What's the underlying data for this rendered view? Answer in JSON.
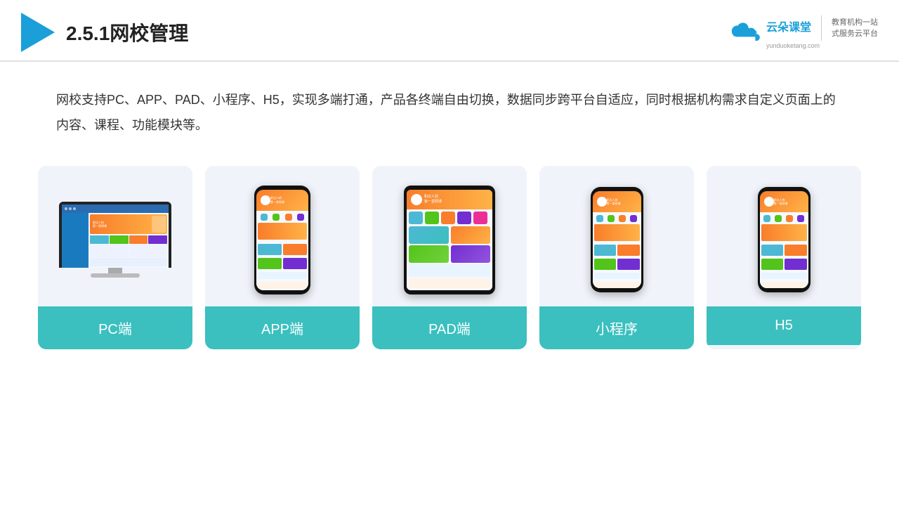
{
  "header": {
    "title": "2.5.1网校管理",
    "brand_cn": "云朵课堂",
    "brand_en": "yunduoketang.com",
    "brand_sub1": "教育机构一站",
    "brand_sub2": "式服务云平台"
  },
  "description": {
    "text": "网校支持PC、APP、PAD、小程序、H5，实现多端打通，产品各终端自由切换，数据同步跨平台自适应，同时根据机构需求自定义页面上的内容、课程、功能模块等。"
  },
  "cards": [
    {
      "id": "pc",
      "label": "PC端"
    },
    {
      "id": "app",
      "label": "APP端"
    },
    {
      "id": "pad",
      "label": "PAD端"
    },
    {
      "id": "miniprogram",
      "label": "小程序"
    },
    {
      "id": "h5",
      "label": "H5"
    }
  ]
}
